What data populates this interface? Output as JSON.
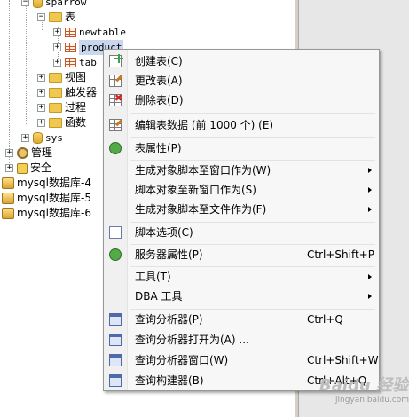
{
  "tree": {
    "items": [
      {
        "label": "sparrow",
        "mono": true
      },
      {
        "label": "表"
      },
      {
        "label": "newtable",
        "mono": true
      },
      {
        "label": "product",
        "mono": true
      },
      {
        "label": "tab",
        "mono": true
      },
      {
        "label": "视图"
      },
      {
        "label": "触发器"
      },
      {
        "label": "过程"
      },
      {
        "label": "函数"
      },
      {
        "label": "sys",
        "mono": true
      },
      {
        "label": "管理"
      },
      {
        "label": "安全"
      },
      {
        "label": "mysql数据库-4"
      },
      {
        "label": "mysql数据库-5"
      },
      {
        "label": "mysql数据库-6"
      }
    ]
  },
  "context_menu": {
    "items": [
      {
        "label": "创建表(C)",
        "icon": "create-table-icon"
      },
      {
        "label": "更改表(A)",
        "icon": "alter-table-icon"
      },
      {
        "label": "删除表(D)",
        "icon": "delete-table-icon"
      },
      {
        "label": "编辑表数据 (前 1000 个) (E)",
        "icon": "edit-data-icon"
      },
      {
        "label": "表属性(P)",
        "icon": "table-properties-icon"
      },
      {
        "label": "生成对象脚本至窗口作为(W)",
        "submenu": true
      },
      {
        "label": "脚本对象至新窗口作为(S)",
        "submenu": true
      },
      {
        "label": "生成对象脚本至文件作为(F)",
        "submenu": true
      },
      {
        "label": "脚本选项(C)",
        "icon": "script-options-icon"
      },
      {
        "label": "服务器属性(P)",
        "icon": "server-properties-icon",
        "shortcut": "Ctrl+Shift+P"
      },
      {
        "label": "工具(T)",
        "submenu": true
      },
      {
        "label": "DBA 工具",
        "submenu": true
      },
      {
        "label": "查询分析器(P)",
        "icon": "query-analyzer-icon",
        "shortcut": "Ctrl+Q"
      },
      {
        "label": "查询分析器打开为(A) ...",
        "icon": "query-analyzer-open-icon"
      },
      {
        "label": "查询分析器窗口(W)",
        "icon": "query-analyzer-window-icon",
        "shortcut": "Ctrl+Shift+W"
      },
      {
        "label": "查询构建器(B)",
        "icon": "query-builder-icon",
        "shortcut": "Ctrl+Alt+Q"
      }
    ]
  },
  "watermark": {
    "brand": "Baidu 经验",
    "site": "jingyan.baidu.com"
  }
}
